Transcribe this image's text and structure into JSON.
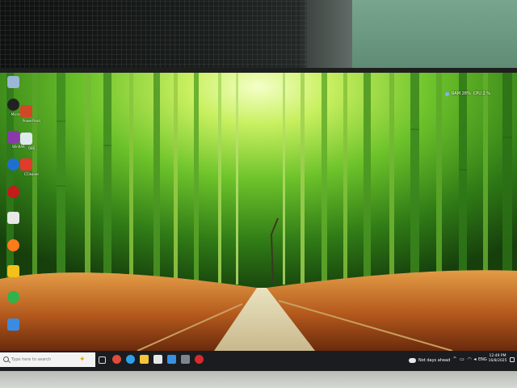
{
  "desktop": {
    "icons": [
      {
        "name": "recycle-bin",
        "label": ""
      },
      {
        "name": "app-shortcut",
        "label": "Microsoft"
      },
      {
        "name": "powerpoint",
        "label": "PowerPoint"
      },
      {
        "name": "winrar",
        "label": "WinRAR"
      },
      {
        "name": "obs",
        "label": "OBS"
      },
      {
        "name": "ccleaner",
        "label": "CCleaner"
      },
      {
        "name": "app-red",
        "label": ""
      },
      {
        "name": "app-doc",
        "label": ""
      },
      {
        "name": "app-blue",
        "label": ""
      },
      {
        "name": "firefox",
        "label": ""
      },
      {
        "name": "app-green",
        "label": ""
      },
      {
        "name": "app-white",
        "label": ""
      }
    ],
    "sys_monitor": {
      "ram": "RAM 28%",
      "cpu": "CPU 2 %"
    }
  },
  "taskbar": {
    "search_placeholder": "Type here to search",
    "apps": [
      "task-view",
      "chrome",
      "edge",
      "file-explorer",
      "store",
      "mail",
      "settings",
      "photos",
      "media"
    ],
    "weather": "Not days ahead",
    "language": "ENG",
    "time": "12:49 PM",
    "date": "16/8/2025"
  },
  "colors": {
    "taskbar_bg": "#1a1c20",
    "search_bg": "#f3f3f3",
    "wallpaper_green": "#7ccf2a",
    "wallpaper_grass": "#c8752a"
  }
}
